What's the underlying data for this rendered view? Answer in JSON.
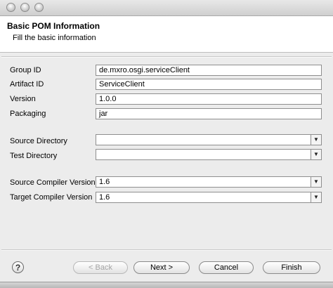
{
  "dialog": {
    "header_title": "Basic POM Information",
    "header_subtitle": "Fill the basic information"
  },
  "form": {
    "group_id_label": "Group ID",
    "group_id_value": "de.mxro.osgi.serviceClient",
    "artifact_id_label": "Artifact ID",
    "artifact_id_value": "ServiceClient",
    "version_label": "Version",
    "version_value": "1.0.0",
    "packaging_label": "Packaging",
    "packaging_value": "jar",
    "source_dir_label": "Source Directory",
    "source_dir_value": "",
    "test_dir_label": "Test Directory",
    "test_dir_value": "",
    "source_compiler_label": "Source Compiler Version",
    "source_compiler_value": "1.6",
    "target_compiler_label": "Target Compiler Version",
    "target_compiler_value": "1.6"
  },
  "buttons": {
    "help": "?",
    "back": "< Back",
    "next": "Next >",
    "cancel": "Cancel",
    "finish": "Finish"
  }
}
